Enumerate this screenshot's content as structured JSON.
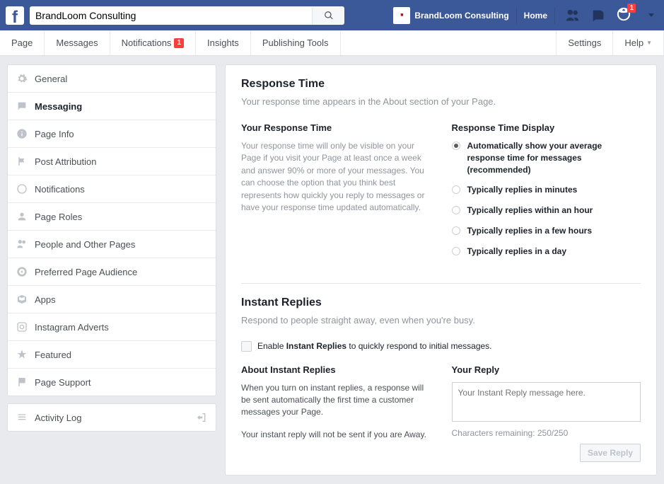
{
  "topbar": {
    "search_value": "BrandLoom Consulting",
    "page_name": "BrandLoom Consulting",
    "home_label": "Home",
    "notif_badge": "1"
  },
  "tabs": {
    "page": "Page",
    "messages": "Messages",
    "notifications": "Notifications",
    "notif_count": "1",
    "insights": "Insights",
    "publishing": "Publishing Tools",
    "settings": "Settings",
    "help": "Help"
  },
  "sidebar": {
    "items": [
      {
        "label": "General"
      },
      {
        "label": "Messaging"
      },
      {
        "label": "Page Info"
      },
      {
        "label": "Post Attribution"
      },
      {
        "label": "Notifications"
      },
      {
        "label": "Page Roles"
      },
      {
        "label": "People and Other Pages"
      },
      {
        "label": "Preferred Page Audience"
      },
      {
        "label": "Apps"
      },
      {
        "label": "Instagram Adverts"
      },
      {
        "label": "Featured"
      },
      {
        "label": "Page Support"
      }
    ],
    "activity_log": "Activity Log"
  },
  "response_time": {
    "title": "Response Time",
    "subtitle": "Your response time appears in the About section of your Page.",
    "left_title": "Your Response Time",
    "left_text": "Your response time will only be visible on your Page if you visit your Page at least once a week and answer 90% or more of your messages. You can choose the option that you think best represents how quickly you reply to messages or have your response time updated automatically.",
    "right_title": "Response Time Display",
    "options": [
      "Automatically show your average response time for messages (recommended)",
      "Typically replies in minutes",
      "Typically replies within an hour",
      "Typically replies in a few hours",
      "Typically replies in a day"
    ]
  },
  "instant_replies": {
    "title": "Instant Replies",
    "subtitle": "Respond to people straight away, even when you're busy.",
    "enable_pre": "Enable ",
    "enable_bold": "Instant Replies",
    "enable_post": " to quickly respond to initial messages.",
    "about_title": "About Instant Replies",
    "about_text": "When you turn on instant replies, a response will be sent automatically the first time a customer messages your Page.",
    "about_note": "Your instant reply will not be sent if you are Away.",
    "reply_title": "Your Reply",
    "placeholder": "Your Instant Reply message here.",
    "chars": "Characters remaining: 250/250",
    "save": "Save Reply"
  }
}
